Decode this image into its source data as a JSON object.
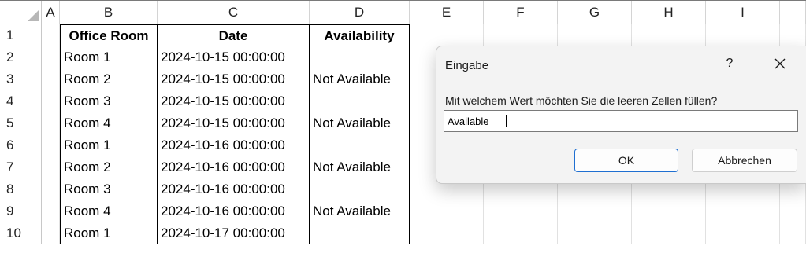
{
  "columns": [
    "A",
    "B",
    "C",
    "D",
    "E",
    "F",
    "G",
    "H",
    "I"
  ],
  "rows": [
    "1",
    "2",
    "3",
    "4",
    "5",
    "6",
    "7",
    "8",
    "9",
    "10"
  ],
  "table": {
    "headers": [
      "Office Room",
      "Date",
      "Availability"
    ],
    "rows": [
      [
        "Room 1",
        "2024-10-15 00:00:00",
        ""
      ],
      [
        "Room 2",
        "2024-10-15 00:00:00",
        "Not Available"
      ],
      [
        "Room 3",
        "2024-10-15 00:00:00",
        ""
      ],
      [
        "Room 4",
        "2024-10-15 00:00:00",
        "Not Available"
      ],
      [
        "Room 1",
        "2024-10-16 00:00:00",
        ""
      ],
      [
        "Room 2",
        "2024-10-16 00:00:00",
        "Not Available"
      ],
      [
        "Room 3",
        "2024-10-16 00:00:00",
        ""
      ],
      [
        "Room 4",
        "2024-10-16 00:00:00",
        "Not Available"
      ],
      [
        "Room 1",
        "2024-10-17 00:00:00",
        ""
      ]
    ]
  },
  "dialog": {
    "title": "Eingabe",
    "help": "?",
    "prompt": "Mit welchem Wert möchten Sie die leeren Zellen füllen?",
    "input_value": "Available",
    "ok_label": "OK",
    "cancel_label": "Abbrechen"
  },
  "icons": {
    "close": "close-icon",
    "select_all": "select-all-icon"
  },
  "colors": {
    "ok_border": "#1f6fd1",
    "dialog_bg": "#f3f3f3"
  }
}
